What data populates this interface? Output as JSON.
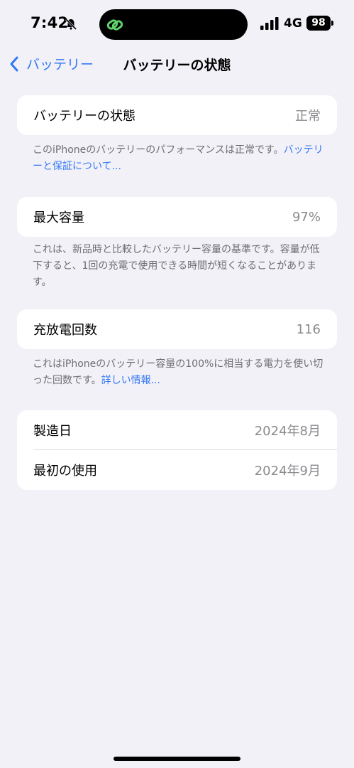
{
  "status": {
    "time": "7:42",
    "network": "4G",
    "battery": "98"
  },
  "nav": {
    "back_label": "バッテリー",
    "title": "バッテリーの状態"
  },
  "health": {
    "label": "バッテリーの状態",
    "value": "正常",
    "footnote": "このiPhoneのバッテリーのパフォーマンスは正常です。",
    "link": "バッテリーと保証について..."
  },
  "capacity": {
    "label": "最大容量",
    "value": "97%",
    "footnote": "これは、新品時と比較したバッテリー容量の基準です。容量が低下すると、1回の充電で使用できる時間が短くなることがあります。"
  },
  "cycles": {
    "label": "充放電回数",
    "value": "116",
    "footnote": "これはiPhoneのバッテリー容量の100%に相当する電力を使い切った回数です。",
    "link": "詳しい情報..."
  },
  "dates": {
    "manufacture_label": "製造日",
    "manufacture_value": "2024年8月",
    "first_use_label": "最初の使用",
    "first_use_value": "2024年9月"
  },
  "colors": {
    "accent": "#3478f6",
    "background": "#f2f1f7",
    "secondary_text": "#8a8a8e"
  },
  "icons": [
    "bell-slash-icon",
    "link-icon",
    "signal-icon",
    "battery-icon",
    "chevron-left-icon"
  ]
}
